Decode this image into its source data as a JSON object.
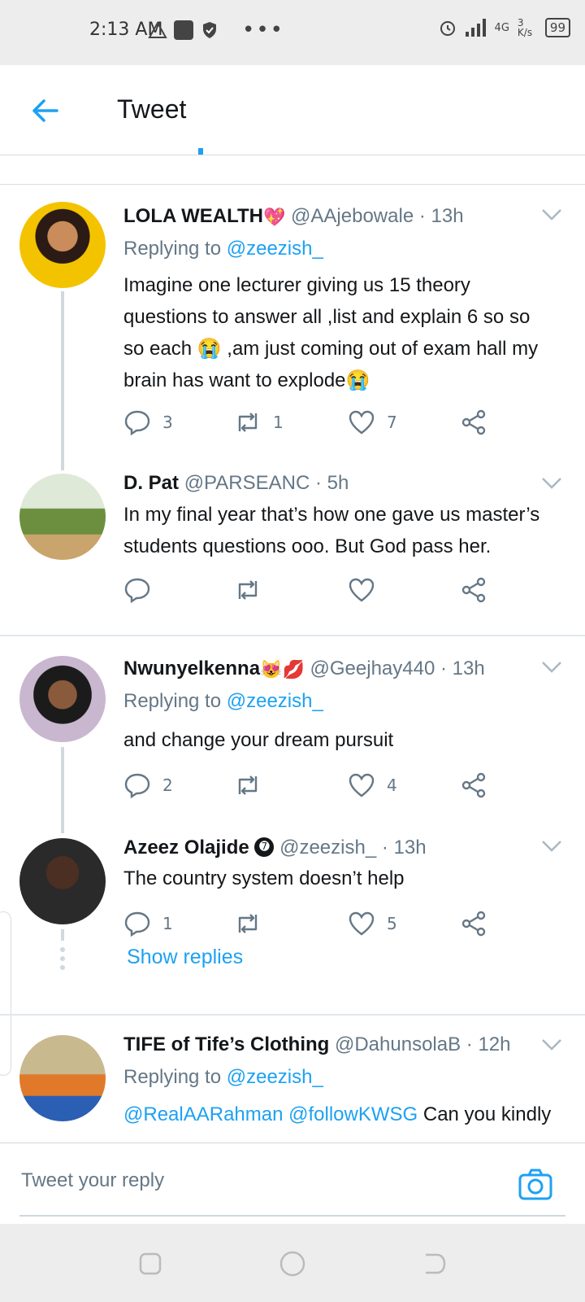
{
  "status_bar": {
    "time": "2:13 AM",
    "network": "4G",
    "speed": "3 K/s",
    "battery": "99"
  },
  "header": {
    "title": "Tweet"
  },
  "tweets": [
    {
      "name": "LOLA WEALTH",
      "name_emoji": "💖",
      "handle": "@AAjebowale",
      "time": "· 13h",
      "replying_label": "Replying to",
      "replying_to": "@zeezish_",
      "lines": [
        "Imagine one lecturer giving us 15 theory",
        "questions to answer all ,list and explain 6 so so",
        "so each 😭 ,am just coming out of exam hall my",
        "brain has want to explode😭"
      ],
      "replies": "3",
      "retweets": "1",
      "likes": "7"
    },
    {
      "name": "D. Pat",
      "handle": "@PARSEANC",
      "time": "· 5h",
      "lines": [
        "In my final year that’s how one gave us master’s",
        "students questions ooo. But God pass her."
      ],
      "replies": "",
      "retweets": "",
      "likes": ""
    },
    {
      "name": "Nwunyelkenna",
      "name_emoji": "😻💋",
      "handle": "@Geejhay440",
      "time": "· 13h",
      "replying_label": "Replying to",
      "replying_to": "@zeezish_",
      "lines": [
        "and change your dream pursuit"
      ],
      "replies": "2",
      "retweets": "",
      "likes": "4"
    },
    {
      "name": "Azeez Olajide",
      "name_emoji": "➐",
      "handle": "@zeezish_",
      "time": "· 13h",
      "lines": [
        "The country system doesn’t help"
      ],
      "replies": "1",
      "retweets": "",
      "likes": "5"
    },
    {
      "name": "TIFE of Tife’s Clothing",
      "handle": "@DahunsolaB",
      "time": "· 12h",
      "replying_label": "Replying to",
      "replying_to": "@zeezish_",
      "mentions": "@RealAARahman @followKWSG",
      "text_tail": "Can you kindly"
    }
  ],
  "show_replies": "Show replies",
  "reply_bar": {
    "placeholder": "Tweet your reply"
  },
  "colors": {
    "accent": "#1da1f2",
    "muted": "#657786",
    "text": "#14171a"
  }
}
